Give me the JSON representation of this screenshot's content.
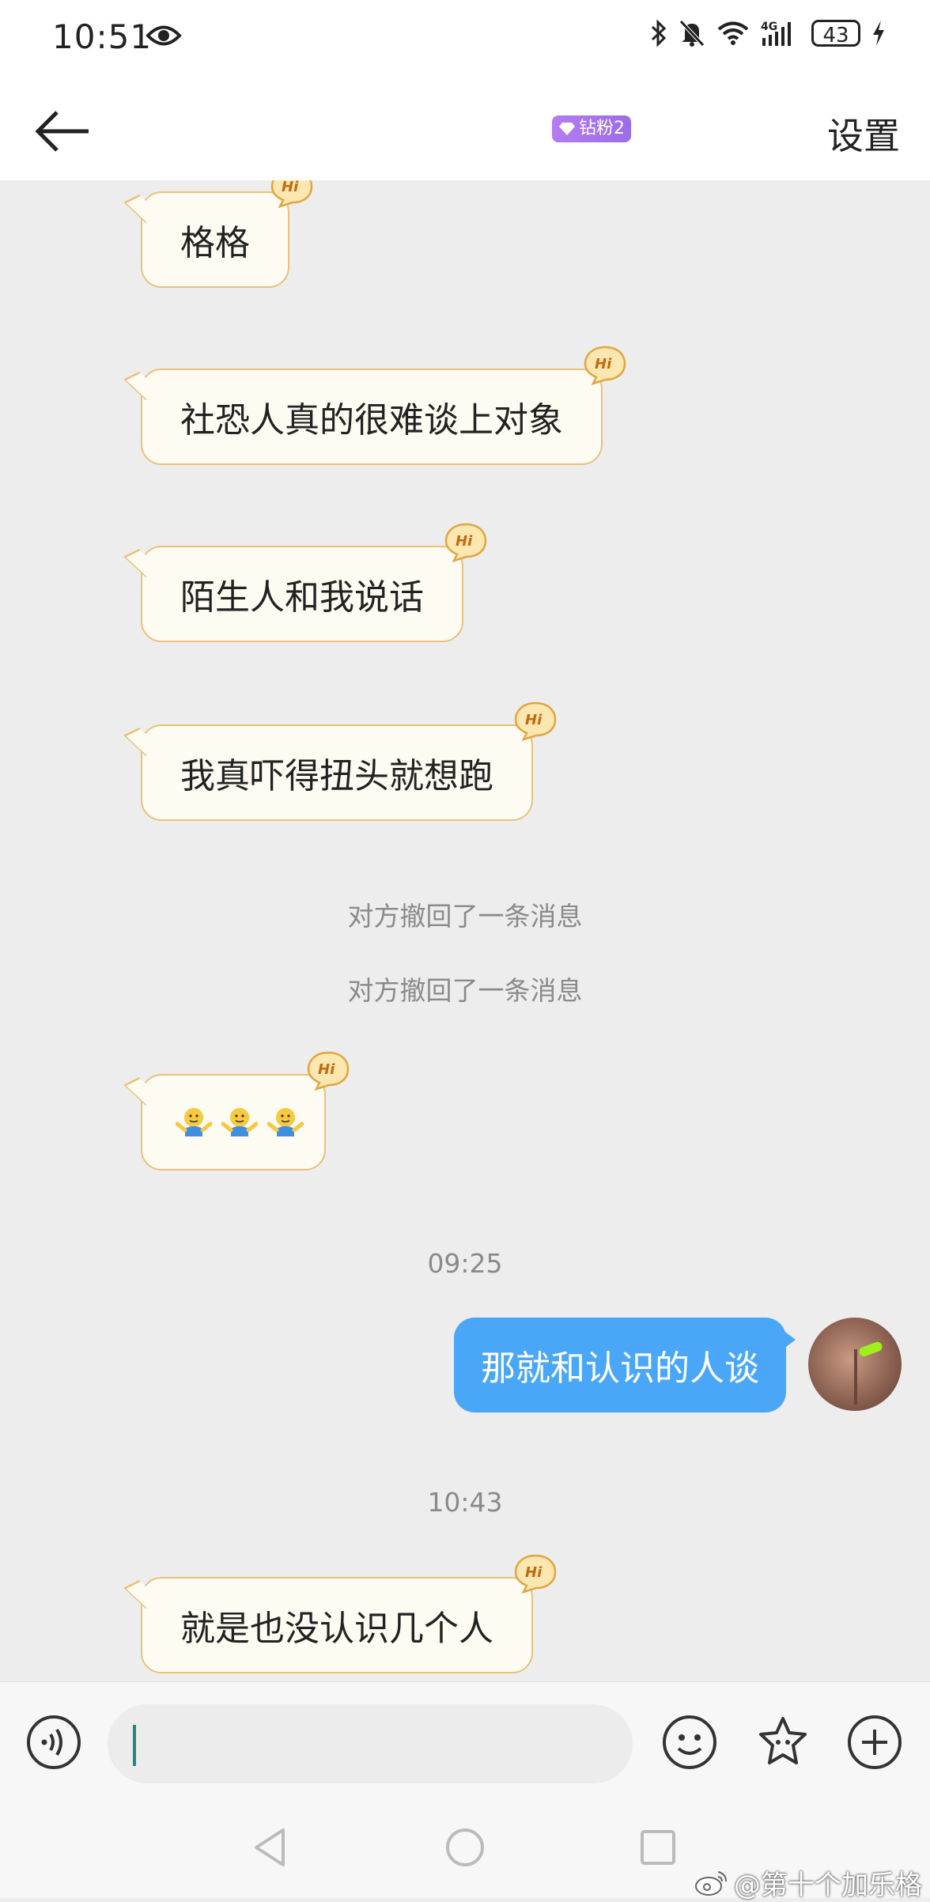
{
  "status_bar": {
    "time": "10:51",
    "battery": "43",
    "network": "4G",
    "icons": [
      "eye-icon",
      "bluetooth-icon",
      "mute-icon",
      "wifi-icon",
      "signal-icon",
      "battery-icon",
      "charging-icon"
    ]
  },
  "header": {
    "back_icon": "arrow-left-icon",
    "badge": "钻粉2",
    "badge_icon": "diamond-icon",
    "settings_label": "设置"
  },
  "messages": {
    "m1": "格格",
    "m2": "社恐人真的很难谈上对象",
    "m3": "陌生人和我说话",
    "m4": "我真吓得扭头就想跑",
    "recall1": "对方撤回了一条消息",
    "recall2": "对方撤回了一条消息",
    "m5_emoji": "shrug-emoji x3",
    "time1": "09:25",
    "out1": "那就和认识的人谈",
    "time2": "10:43",
    "m6": "就是也没认识几个人",
    "hi_label": "Hi"
  },
  "input_bar": {
    "text_value": "",
    "icons": [
      "voice-icon",
      "emoji-icon",
      "sticker-icon",
      "plus-icon"
    ]
  },
  "nav_bar": {
    "icons": [
      "nav-back-icon",
      "nav-home-icon",
      "nav-recents-icon"
    ]
  },
  "watermark": {
    "text": "@第十个加乐格",
    "icon": "weibo-icon"
  },
  "colors": {
    "incoming_bubble_bg": "#fdfbf2",
    "incoming_bubble_border": "#e8c27a",
    "outgoing_bubble_bg": "#4aa7f7",
    "chat_bg": "#ededed",
    "badge": "#a874ec"
  }
}
